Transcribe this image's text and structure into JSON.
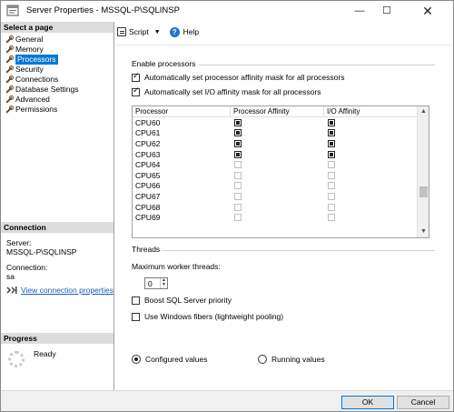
{
  "window": {
    "title": "Server Properties - MSSQL-P\\SQLINSP",
    "minimize": "—",
    "maximize": "☐",
    "close": "✕"
  },
  "left": {
    "select_heading": "Select a page",
    "pages": [
      {
        "label": "General"
      },
      {
        "label": "Memory"
      },
      {
        "label": "Processors",
        "selected": true
      },
      {
        "label": "Security"
      },
      {
        "label": "Connections"
      },
      {
        "label": "Database Settings"
      },
      {
        "label": "Advanced"
      },
      {
        "label": "Permissions"
      }
    ],
    "connection_heading": "Connection",
    "server_label": "Server:",
    "server_value": "MSSQL-P\\SQLINSP",
    "connection_label": "Connection:",
    "connection_value": "sa",
    "view_link": "View connection properties",
    "progress_heading": "Progress",
    "progress_status": "Ready"
  },
  "toolbar": {
    "script_label": "Script",
    "help_label": "Help"
  },
  "enable": {
    "title": "Enable processors",
    "auto_processor_label": "Automatically set processor affinity mask for all processors",
    "auto_io_label": "Automatically set I/O affinity mask for all processors",
    "auto_processor_checked": true,
    "auto_io_checked": true
  },
  "grid": {
    "headers": [
      "Processor",
      "Processor Affinity",
      "I/O Affinity"
    ],
    "rows": [
      {
        "name": "CPU60",
        "proc": true,
        "io": true
      },
      {
        "name": "CPU61",
        "proc": true,
        "io": true
      },
      {
        "name": "CPU62",
        "proc": true,
        "io": true
      },
      {
        "name": "CPU63",
        "proc": true,
        "io": true
      },
      {
        "name": "CPU64",
        "proc": false,
        "io": false
      },
      {
        "name": "CPU65",
        "proc": false,
        "io": false
      },
      {
        "name": "CPU66",
        "proc": false,
        "io": false
      },
      {
        "name": "CPU67",
        "proc": false,
        "io": false
      },
      {
        "name": "CPU68",
        "proc": false,
        "io": false
      },
      {
        "name": "CPU69",
        "proc": false,
        "io": false
      }
    ]
  },
  "threads": {
    "title": "Threads",
    "max_workers_label": "Maximum worker threads:",
    "max_workers_value": "0",
    "boost_label": "Boost SQL Server priority",
    "fibers_label": "Use Windows fibers (lightweight pooling)"
  },
  "values": {
    "configured_label": "Configured values",
    "running_label": "Running values"
  },
  "buttons": {
    "ok": "OK",
    "cancel": "Cancel"
  }
}
